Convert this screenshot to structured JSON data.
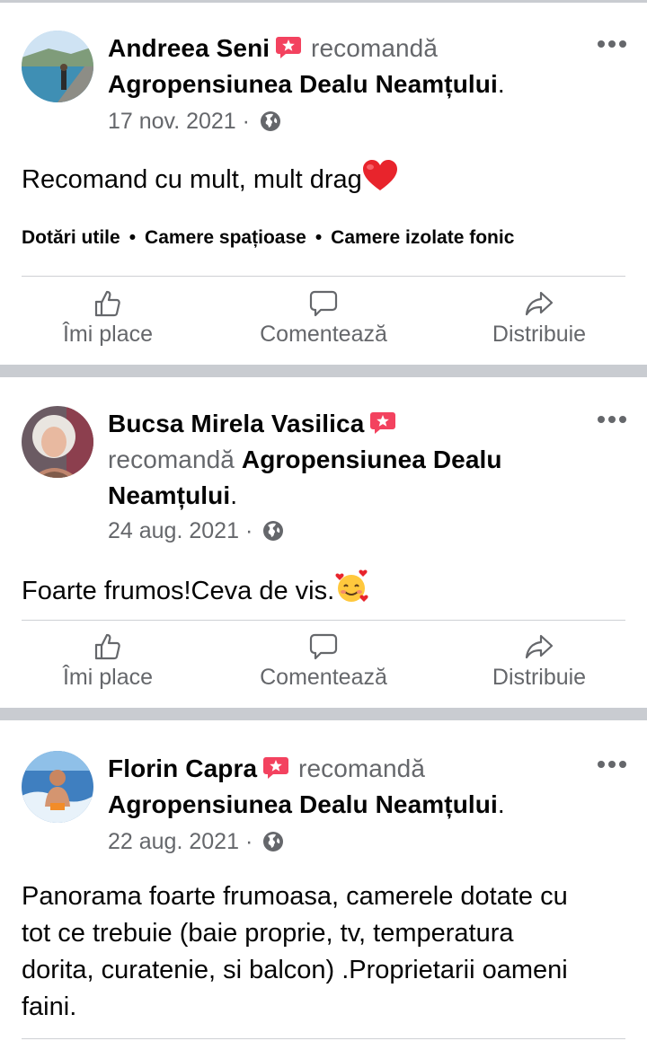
{
  "posts": [
    {
      "author": "Andreea Seni",
      "verb": "recomandă",
      "page": "Agropensiunea Dealu Neamțului",
      "date": "17 nov. 2021",
      "text": "Recomand cu mult, mult drag",
      "emoji": "red-heart-emoji",
      "tags": [
        "Dotări utile",
        "Camere spațioase",
        "Camere izolate fonic"
      ]
    },
    {
      "author": "Bucsa Mirela Vasilica",
      "verb": "recomandă",
      "page": "Agropensiunea Dealu Neamțului",
      "date": "24 aug. 2021",
      "text": "Foarte frumos!Ceva de vis.",
      "emoji": "smiling-face-with-hearts-emoji"
    },
    {
      "author": "Florin Capra",
      "verb": "recomandă",
      "page": "Agropensiunea Dealu Neamțului",
      "date": "22 aug. 2021",
      "text_lines": [
        "Panorama foarte frumoasa, camerele dotate cu",
        "tot ce trebuie (baie proprie, tv, temperatura",
        "dorita, curatenie, si balcon) .Proprietarii oameni",
        "faini."
      ]
    }
  ],
  "actions": {
    "like": "Îmi place",
    "comment": "Comentează",
    "share": "Distribuie"
  },
  "punctuation": {
    "period": ".",
    "sep_dot": "·"
  },
  "colors": {
    "recommend_badge": "#f3425f",
    "secondary_text": "#65676b",
    "divider": "#c9ccd1"
  }
}
